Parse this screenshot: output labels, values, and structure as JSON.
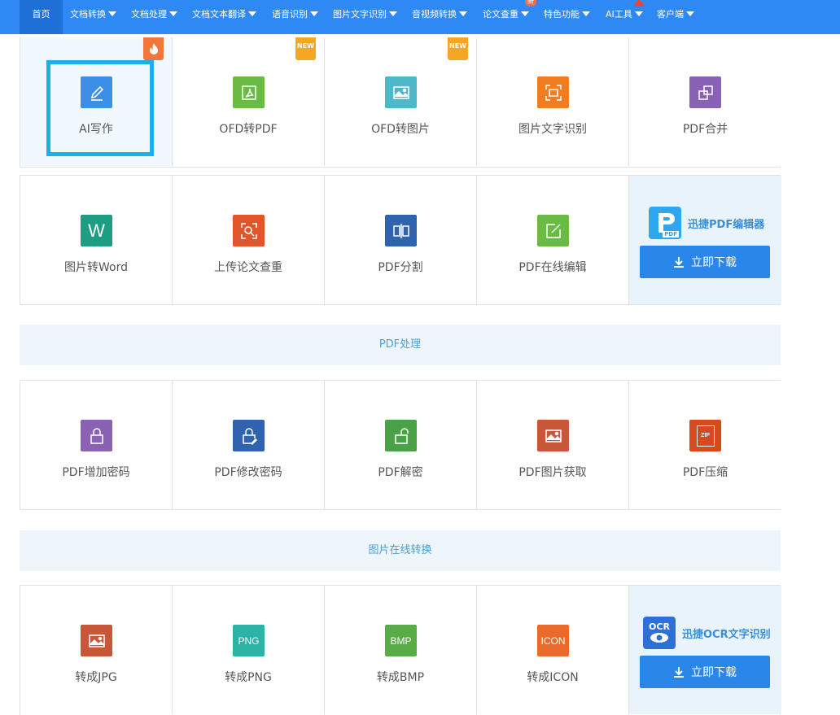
{
  "nav": {
    "home": "首页",
    "items": [
      "文档转换",
      "文档处理",
      "文档文本翻译",
      "语音识别",
      "图片文字识别",
      "音视频转换",
      "论文查重",
      "特色功能",
      "AI工具",
      "客户端"
    ],
    "badge_new": "新"
  },
  "row1": [
    {
      "label": "AI写作",
      "icon": "pen-edit-icon",
      "color": "#3d8ee6"
    },
    {
      "label": "OFD转PDF",
      "icon": "pdf-file-icon",
      "color": "#6abb45"
    },
    {
      "label": "OFD转图片",
      "icon": "image-icon",
      "color": "#4fb8c8"
    },
    {
      "label": "图片文字识别",
      "icon": "ocr-scan-icon",
      "color": "#f07d22"
    },
    {
      "label": "PDF合并",
      "icon": "merge-icon",
      "color": "#8a62b3"
    }
  ],
  "row1_badges": {
    "new": "NEW"
  },
  "row2": [
    {
      "label": "图片转Word",
      "icon": "word-icon",
      "color": "#1d9e83",
      "glyph": "W"
    },
    {
      "label": "上传论文查重",
      "icon": "paper-check-icon",
      "color": "#e2542a"
    },
    {
      "label": "PDF分割",
      "icon": "split-icon",
      "color": "#2f63ad"
    },
    {
      "label": "PDF在线编辑",
      "icon": "online-edit-icon",
      "color": "#6abb45"
    }
  ],
  "promo1": {
    "title": "迅捷PDF编辑器",
    "button": "立即下载",
    "logo_text": "PDF"
  },
  "section1": "PDF处理",
  "row3": [
    {
      "label": "PDF增加密码",
      "icon": "lock-icon",
      "color": "#8a62b3"
    },
    {
      "label": "PDF修改密码",
      "icon": "lock-edit-icon",
      "color": "#2f63ad"
    },
    {
      "label": "PDF解密",
      "icon": "unlock-icon",
      "color": "#4aa247"
    },
    {
      "label": "PDF图片获取",
      "icon": "image-extract-icon",
      "color": "#c8573a"
    },
    {
      "label": "PDF压缩",
      "icon": "zip-icon",
      "color": "#d8491f",
      "glyph": "ZIP"
    }
  ],
  "section2": "图片在线转换",
  "row4": [
    {
      "label": "转成JPG",
      "icon": "jpg-icon",
      "color": "#c8573a"
    },
    {
      "label": "转成PNG",
      "icon": "png-icon",
      "color": "#2bb3a6",
      "glyph": "PNG"
    },
    {
      "label": "转成BMP",
      "icon": "bmp-icon",
      "color": "#5aac47",
      "glyph": "BMP"
    },
    {
      "label": "转成ICON",
      "icon": "ico-icon",
      "color": "#e96a2b",
      "glyph": "ICON"
    }
  ],
  "promo2": {
    "title": "迅捷OCR文字识别",
    "button": "立即下载",
    "logo_text": "OCR"
  }
}
